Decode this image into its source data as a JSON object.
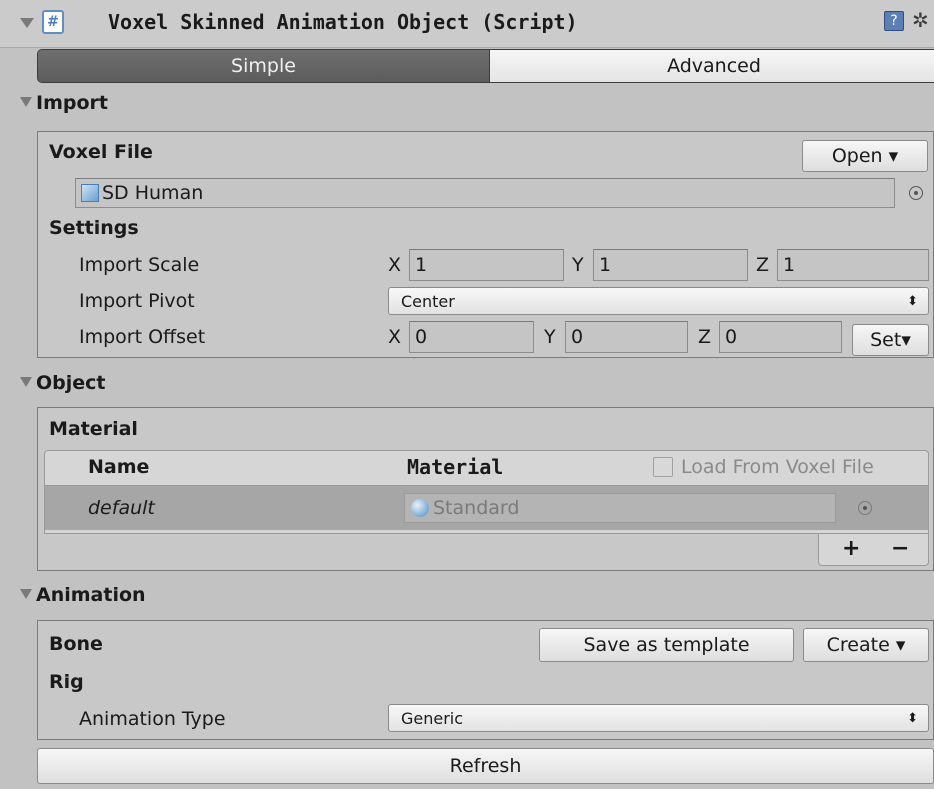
{
  "header": {
    "title": "Voxel Skinned Animation Object (Script)",
    "script_icon_glyph": "#",
    "help_icon_glyph": "?",
    "gear_glyph": "✲"
  },
  "tabs": {
    "simple": "Simple",
    "advanced": "Advanced"
  },
  "import": {
    "title": "Import",
    "voxel_file_label": "Voxel File",
    "open_button": "Open ▾",
    "voxel_file_value": "SD Human",
    "settings_label": "Settings",
    "scale_label": "Import Scale",
    "scale": {
      "x_label": "X",
      "x": "1",
      "y_label": "Y",
      "y": "1",
      "z_label": "Z",
      "z": "1"
    },
    "pivot_label": "Import Pivot",
    "pivot_value": "Center",
    "offset_label": "Import Offset",
    "offset": {
      "x_label": "X",
      "x": "0",
      "y_label": "Y",
      "y": "0",
      "z_label": "Z",
      "z": "0"
    },
    "set_button": "Set▾"
  },
  "object": {
    "title": "Object",
    "material_label": "Material",
    "col_name": "Name",
    "col_material": "Material",
    "load_from_voxel_label": "Load From Voxel File",
    "load_from_voxel_checked": false,
    "row_name": "default",
    "row_material": "Standard",
    "add_glyph": "+",
    "remove_glyph": "−"
  },
  "animation": {
    "title": "Animation",
    "bone_label": "Bone",
    "save_template_button": "Save as template",
    "create_button": "Create ▾",
    "rig_label": "Rig",
    "anim_type_label": "Animation Type",
    "anim_type_value": "Generic"
  },
  "refresh_button": "Refresh",
  "popup_arrows": "⬍"
}
